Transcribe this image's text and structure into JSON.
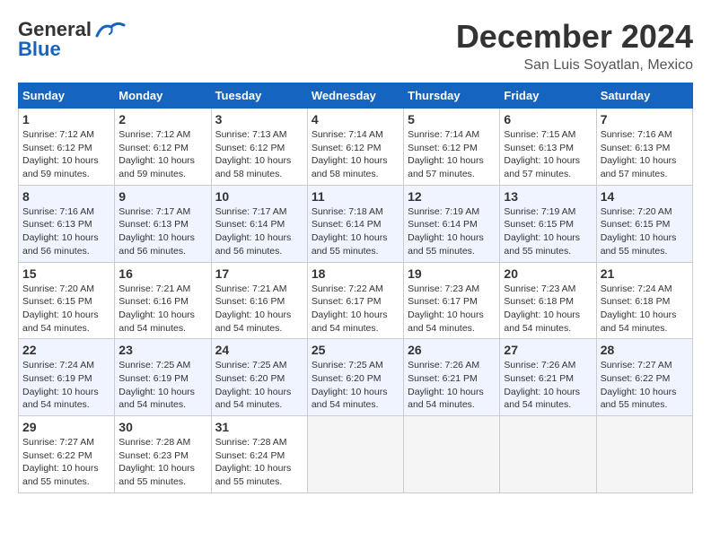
{
  "header": {
    "logo_general": "General",
    "logo_blue": "Blue",
    "month": "December 2024",
    "location": "San Luis Soyatlan, Mexico"
  },
  "weekdays": [
    "Sunday",
    "Monday",
    "Tuesday",
    "Wednesday",
    "Thursday",
    "Friday",
    "Saturday"
  ],
  "weeks": [
    [
      {
        "day": "1",
        "info": "Sunrise: 7:12 AM\nSunset: 6:12 PM\nDaylight: 10 hours\nand 59 minutes."
      },
      {
        "day": "2",
        "info": "Sunrise: 7:12 AM\nSunset: 6:12 PM\nDaylight: 10 hours\nand 59 minutes."
      },
      {
        "day": "3",
        "info": "Sunrise: 7:13 AM\nSunset: 6:12 PM\nDaylight: 10 hours\nand 58 minutes."
      },
      {
        "day": "4",
        "info": "Sunrise: 7:14 AM\nSunset: 6:12 PM\nDaylight: 10 hours\nand 58 minutes."
      },
      {
        "day": "5",
        "info": "Sunrise: 7:14 AM\nSunset: 6:12 PM\nDaylight: 10 hours\nand 57 minutes."
      },
      {
        "day": "6",
        "info": "Sunrise: 7:15 AM\nSunset: 6:13 PM\nDaylight: 10 hours\nand 57 minutes."
      },
      {
        "day": "7",
        "info": "Sunrise: 7:16 AM\nSunset: 6:13 PM\nDaylight: 10 hours\nand 57 minutes."
      }
    ],
    [
      {
        "day": "8",
        "info": "Sunrise: 7:16 AM\nSunset: 6:13 PM\nDaylight: 10 hours\nand 56 minutes."
      },
      {
        "day": "9",
        "info": "Sunrise: 7:17 AM\nSunset: 6:13 PM\nDaylight: 10 hours\nand 56 minutes."
      },
      {
        "day": "10",
        "info": "Sunrise: 7:17 AM\nSunset: 6:14 PM\nDaylight: 10 hours\nand 56 minutes."
      },
      {
        "day": "11",
        "info": "Sunrise: 7:18 AM\nSunset: 6:14 PM\nDaylight: 10 hours\nand 55 minutes."
      },
      {
        "day": "12",
        "info": "Sunrise: 7:19 AM\nSunset: 6:14 PM\nDaylight: 10 hours\nand 55 minutes."
      },
      {
        "day": "13",
        "info": "Sunrise: 7:19 AM\nSunset: 6:15 PM\nDaylight: 10 hours\nand 55 minutes."
      },
      {
        "day": "14",
        "info": "Sunrise: 7:20 AM\nSunset: 6:15 PM\nDaylight: 10 hours\nand 55 minutes."
      }
    ],
    [
      {
        "day": "15",
        "info": "Sunrise: 7:20 AM\nSunset: 6:15 PM\nDaylight: 10 hours\nand 54 minutes."
      },
      {
        "day": "16",
        "info": "Sunrise: 7:21 AM\nSunset: 6:16 PM\nDaylight: 10 hours\nand 54 minutes."
      },
      {
        "day": "17",
        "info": "Sunrise: 7:21 AM\nSunset: 6:16 PM\nDaylight: 10 hours\nand 54 minutes."
      },
      {
        "day": "18",
        "info": "Sunrise: 7:22 AM\nSunset: 6:17 PM\nDaylight: 10 hours\nand 54 minutes."
      },
      {
        "day": "19",
        "info": "Sunrise: 7:23 AM\nSunset: 6:17 PM\nDaylight: 10 hours\nand 54 minutes."
      },
      {
        "day": "20",
        "info": "Sunrise: 7:23 AM\nSunset: 6:18 PM\nDaylight: 10 hours\nand 54 minutes."
      },
      {
        "day": "21",
        "info": "Sunrise: 7:24 AM\nSunset: 6:18 PM\nDaylight: 10 hours\nand 54 minutes."
      }
    ],
    [
      {
        "day": "22",
        "info": "Sunrise: 7:24 AM\nSunset: 6:19 PM\nDaylight: 10 hours\nand 54 minutes."
      },
      {
        "day": "23",
        "info": "Sunrise: 7:25 AM\nSunset: 6:19 PM\nDaylight: 10 hours\nand 54 minutes."
      },
      {
        "day": "24",
        "info": "Sunrise: 7:25 AM\nSunset: 6:20 PM\nDaylight: 10 hours\nand 54 minutes."
      },
      {
        "day": "25",
        "info": "Sunrise: 7:25 AM\nSunset: 6:20 PM\nDaylight: 10 hours\nand 54 minutes."
      },
      {
        "day": "26",
        "info": "Sunrise: 7:26 AM\nSunset: 6:21 PM\nDaylight: 10 hours\nand 54 minutes."
      },
      {
        "day": "27",
        "info": "Sunrise: 7:26 AM\nSunset: 6:21 PM\nDaylight: 10 hours\nand 54 minutes."
      },
      {
        "day": "28",
        "info": "Sunrise: 7:27 AM\nSunset: 6:22 PM\nDaylight: 10 hours\nand 55 minutes."
      }
    ],
    [
      {
        "day": "29",
        "info": "Sunrise: 7:27 AM\nSunset: 6:22 PM\nDaylight: 10 hours\nand 55 minutes."
      },
      {
        "day": "30",
        "info": "Sunrise: 7:28 AM\nSunset: 6:23 PM\nDaylight: 10 hours\nand 55 minutes."
      },
      {
        "day": "31",
        "info": "Sunrise: 7:28 AM\nSunset: 6:24 PM\nDaylight: 10 hours\nand 55 minutes."
      },
      {
        "day": "",
        "info": ""
      },
      {
        "day": "",
        "info": ""
      },
      {
        "day": "",
        "info": ""
      },
      {
        "day": "",
        "info": ""
      }
    ]
  ]
}
